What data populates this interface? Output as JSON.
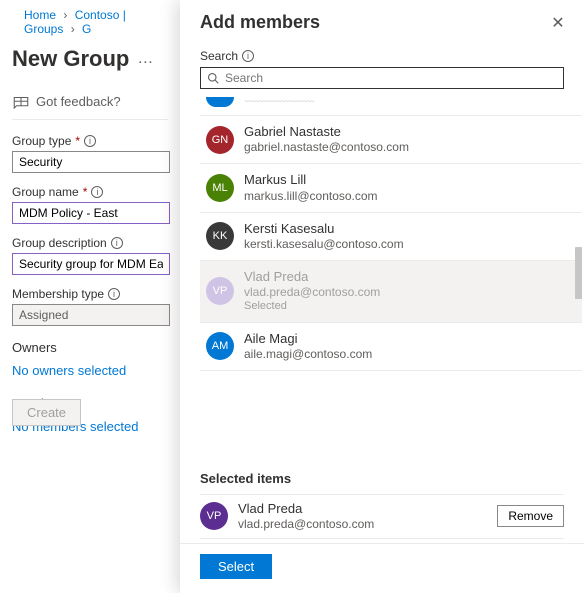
{
  "breadcrumb": {
    "items": [
      "Home",
      "Contoso | Groups",
      "G"
    ]
  },
  "page": {
    "title": "New Group",
    "feedback_label": "Got feedback?",
    "group_type_label": "Group type",
    "group_type_value": "Security",
    "group_name_label": "Group name",
    "group_name_value": "MDM Policy - East",
    "group_desc_label": "Group description",
    "group_desc_value": "Security group for MDM East",
    "membership_type_label": "Membership type",
    "membership_type_value": "Assigned",
    "owners_label": "Owners",
    "owners_link": "No owners selected",
    "members_label": "Members",
    "members_link": "No members selected",
    "create_label": "Create"
  },
  "panel": {
    "title": "Add members",
    "search_label": "Search",
    "search_placeholder": "Search",
    "results": [
      {
        "initials": "",
        "color": "#0078d4",
        "name": "",
        "email": "",
        "partial": true
      },
      {
        "initials": "GN",
        "color": "#a4262c",
        "name": "Gabriel Nastaste",
        "email": "gabriel.nastaste@contoso.com"
      },
      {
        "initials": "ML",
        "color": "#498205",
        "name": "Markus Lill",
        "email": "markus.lill@contoso.com"
      },
      {
        "initials": "KK",
        "color": "#393939",
        "name": "Kersti Kasesalu",
        "email": "kersti.kasesalu@contoso.com"
      },
      {
        "initials": "VP",
        "color": "#cfc4e6",
        "name": "Vlad Preda",
        "email": "vlad.preda@contoso.com",
        "selected": true,
        "selected_label": "Selected"
      },
      {
        "initials": "AM",
        "color": "#0078d4",
        "name": "Aile Magi",
        "email": "aile.magi@contoso.com"
      }
    ],
    "selected_title": "Selected items",
    "selected_items": [
      {
        "initials": "VP",
        "color": "#5c2e91",
        "name": "Vlad Preda",
        "email": "vlad.preda@contoso.com"
      }
    ],
    "remove_label": "Remove",
    "select_label": "Select"
  }
}
